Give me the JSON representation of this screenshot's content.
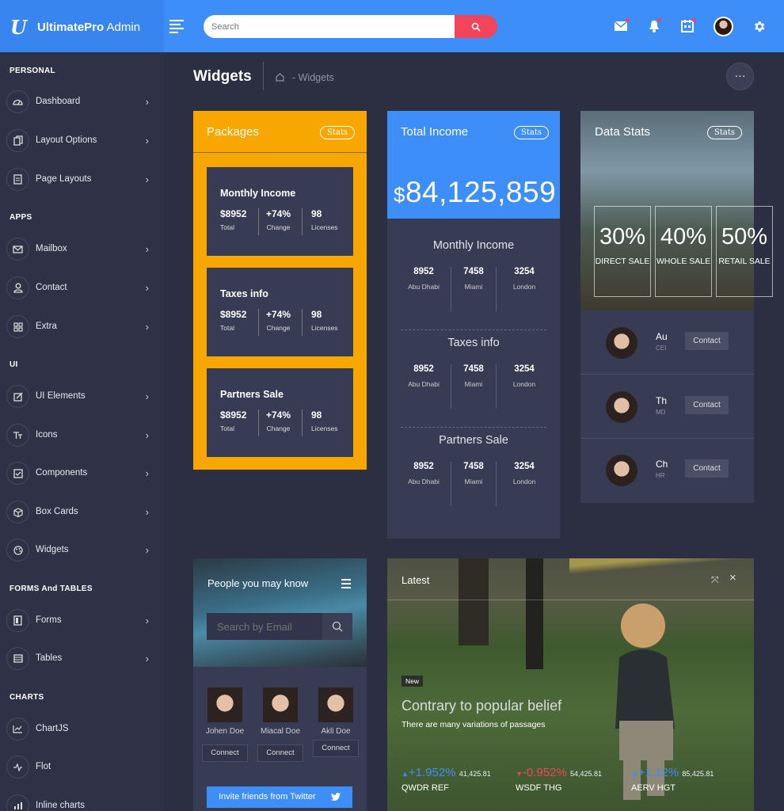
{
  "topbar": {
    "brand_bold": "UltimatePro",
    "brand_light": " Admin",
    "search_placeholder": "Search"
  },
  "sidebar": {
    "sections": {
      "personal": "PERSONAL",
      "apps": "APPS",
      "ui": "UI",
      "forms": "FORMS And TABLES",
      "charts": "CHARTS"
    },
    "items": [
      {
        "label": "Dashboard",
        "icon": "dashboard-gauge-icon"
      },
      {
        "label": "Layout Options",
        "icon": "layout-copy-icon"
      },
      {
        "label": "Page Layouts",
        "icon": "page-layouts-icon"
      },
      {
        "label": "Mailbox",
        "icon": "mail-icon"
      },
      {
        "label": "Contact",
        "icon": "user-icon"
      },
      {
        "label": "Extra",
        "icon": "grid-icon"
      },
      {
        "label": "UI Elements",
        "icon": "edit-icon"
      },
      {
        "label": "Icons",
        "icon": "text-icon"
      },
      {
        "label": "Components",
        "icon": "check-square-icon"
      },
      {
        "label": "Box Cards",
        "icon": "box-icon"
      },
      {
        "label": "Widgets",
        "icon": "palette-icon"
      },
      {
        "label": "Forms",
        "icon": "forms-icon"
      },
      {
        "label": "Tables",
        "icon": "table-icon"
      },
      {
        "label": "ChartJS",
        "icon": "line-chart-icon"
      },
      {
        "label": "Flot",
        "icon": "activity-icon"
      },
      {
        "label": "Inline charts",
        "icon": "bar-chart-icon"
      }
    ]
  },
  "page": {
    "title": "Widgets",
    "breadcrumb": "- Widgets",
    "more": "···"
  },
  "packages": {
    "title": "Packages",
    "stats": "Stats",
    "cards": [
      {
        "title": "Monthly Income",
        "total": "$8952",
        "total_label": "Total",
        "change": "+74%",
        "change_label": "Change",
        "licenses": "98",
        "licenses_label": "Licenses"
      },
      {
        "title": "Taxes info",
        "total": "$8952",
        "total_label": "Total",
        "change": "+74%",
        "change_label": "Change",
        "licenses": "98",
        "licenses_label": "Licenses"
      },
      {
        "title": "Partners Sale",
        "total": "$8952",
        "total_label": "Total",
        "change": "+74%",
        "change_label": "Change",
        "licenses": "98",
        "licenses_label": "Licenses"
      }
    ]
  },
  "income": {
    "title": "Total Income",
    "stats": "Stats",
    "currency": "$",
    "amount": "84,125,859",
    "sections": [
      {
        "title": "Monthly Income",
        "cols": [
          {
            "v": "8952",
            "l": "Abu Dhabi"
          },
          {
            "v": "7458",
            "l": "Miami"
          },
          {
            "v": "3254",
            "l": "London"
          }
        ]
      },
      {
        "title": "Taxes info",
        "cols": [
          {
            "v": "8952",
            "l": "Abu Dhabi"
          },
          {
            "v": "7458",
            "l": "Miami"
          },
          {
            "v": "3254",
            "l": "London"
          }
        ]
      },
      {
        "title": "Partners Sale",
        "cols": [
          {
            "v": "8952",
            "l": "Abu Dhabi"
          },
          {
            "v": "7458",
            "l": "Miami"
          },
          {
            "v": "3254",
            "l": "London"
          }
        ]
      }
    ]
  },
  "data_stats": {
    "title": "Data Stats",
    "stats": "Stats",
    "boxes": [
      {
        "value": "30%",
        "label": "DIRECT SALE"
      },
      {
        "value": "40%",
        "label": "WHOLE SALE"
      },
      {
        "value": "50%",
        "label": "RETAIL SALE"
      }
    ],
    "people": [
      {
        "name": "Au",
        "role": "CEI",
        "button": "Contact"
      },
      {
        "name": "Th",
        "role": "MD",
        "button": "Contact"
      },
      {
        "name": "Ch",
        "role": "HR",
        "button": "Contact"
      }
    ]
  },
  "people": {
    "title": "People you may know",
    "search_placeholder": "Search by Email",
    "list": [
      {
        "name": "Johen Doe",
        "button": "Connect"
      },
      {
        "name": "Miacal Doe",
        "button": "Connect"
      },
      {
        "name": "Akli Doe",
        "button": "Connect"
      }
    ],
    "twitter": "Invite friends from Twitter"
  },
  "latest": {
    "title": "Latest",
    "badge": "New",
    "headline": "Contrary to popular belief",
    "subtitle": "There are many variations of passages",
    "tickers": [
      {
        "change": "+1.952%",
        "value": "41,425.81",
        "name": "QWDR REF",
        "direction": "up",
        "color": "#3d8ef8"
      },
      {
        "change": "-0.952%",
        "value": "54,425.81",
        "name": "WSDF THG",
        "direction": "down",
        "color": "#f2455b"
      },
      {
        "change": "+1.12%",
        "value": "85,425.81",
        "name": "AERV HGT",
        "direction": "up",
        "color": "#3d8ef8"
      }
    ]
  },
  "colors": {
    "primary": "#3d8ef8",
    "warning": "#f8a600",
    "danger": "#f2455b",
    "sidebar": "#2f3246",
    "card": "#383b54",
    "background": "#2c2f41"
  }
}
